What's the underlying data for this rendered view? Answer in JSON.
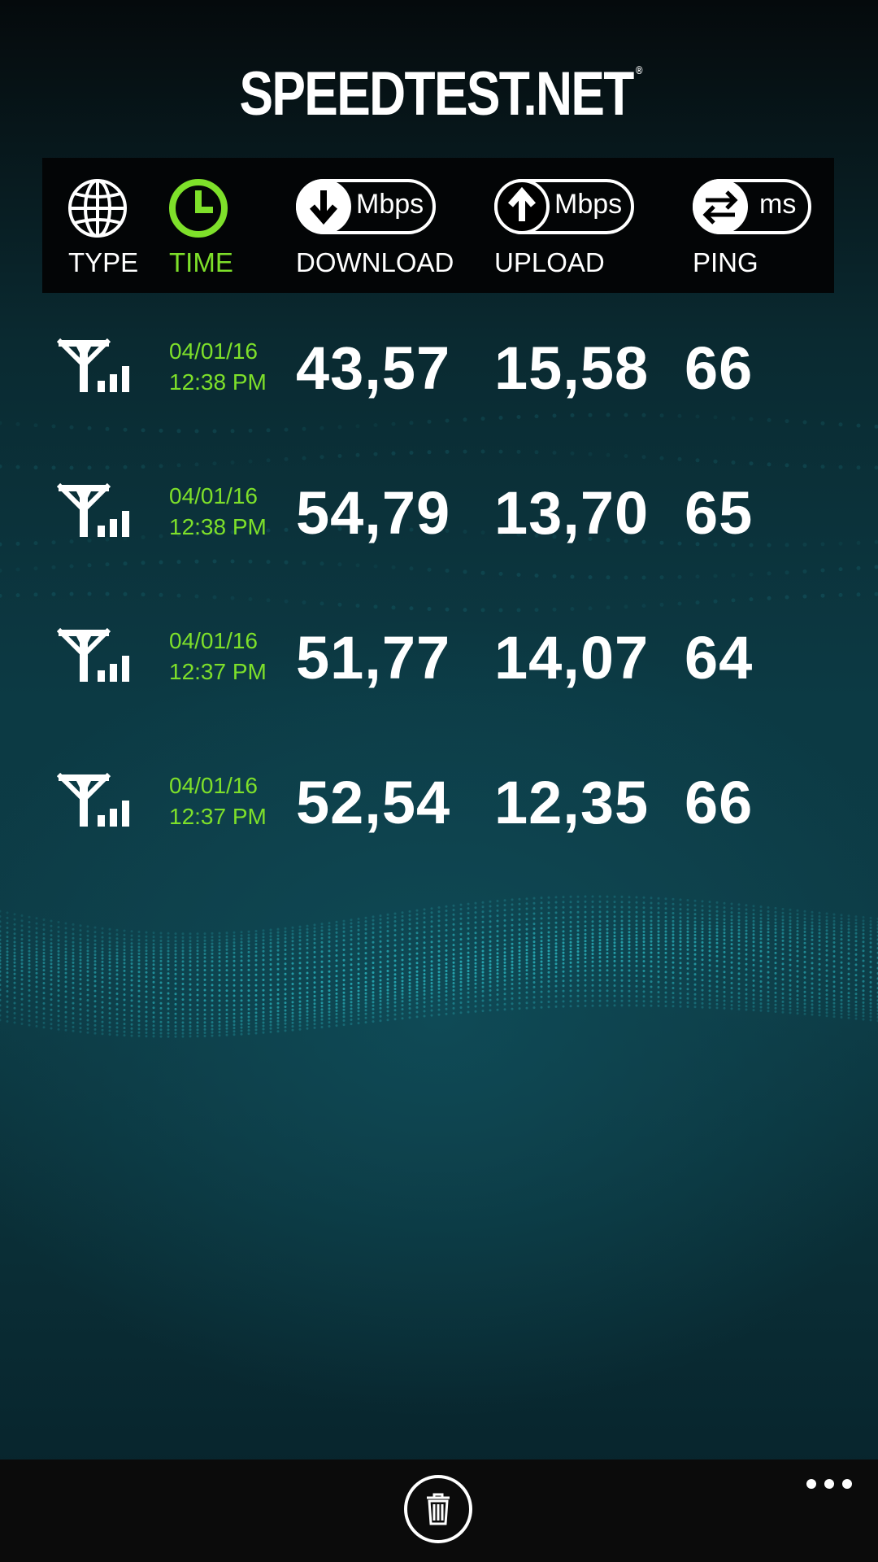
{
  "app": {
    "logo_text": "SPEEDTEST.NET",
    "logo_mark": "®"
  },
  "header": {
    "columns": [
      {
        "key": "type",
        "label": "TYPE",
        "icon": "globe-icon",
        "active": false
      },
      {
        "key": "time",
        "label": "TIME",
        "icon": "clock-icon",
        "active": true
      },
      {
        "key": "download",
        "label": "DOWNLOAD",
        "icon": "download-arrow-icon",
        "unit": "Mbps",
        "active": false
      },
      {
        "key": "upload",
        "label": "UPLOAD",
        "icon": "upload-arrow-icon",
        "unit": "Mbps",
        "active": false
      },
      {
        "key": "ping",
        "label": "PING",
        "icon": "ping-arrows-icon",
        "unit": "ms",
        "active": false
      }
    ]
  },
  "results": [
    {
      "type_icon": "cell-signal-icon",
      "date": "04/01/16",
      "time": "12:38 PM",
      "download": "43,57",
      "upload": "15,58",
      "ping": "66"
    },
    {
      "type_icon": "cell-signal-icon",
      "date": "04/01/16",
      "time": "12:38 PM",
      "download": "54,79",
      "upload": "13,70",
      "ping": "65"
    },
    {
      "type_icon": "cell-signal-icon",
      "date": "04/01/16",
      "time": "12:37 PM",
      "download": "51,77",
      "upload": "14,07",
      "ping": "64"
    },
    {
      "type_icon": "cell-signal-icon",
      "date": "04/01/16",
      "time": "12:37 PM",
      "download": "52,54",
      "upload": "12,35",
      "ping": "66"
    }
  ],
  "appbar": {
    "delete_icon": "trash-icon",
    "more_icon": "ellipsis-icon"
  },
  "colors": {
    "accent_green": "#7ee02a",
    "background": "#0c3a44",
    "header_bar": "#030506",
    "app_bar": "#0b0b0b"
  }
}
